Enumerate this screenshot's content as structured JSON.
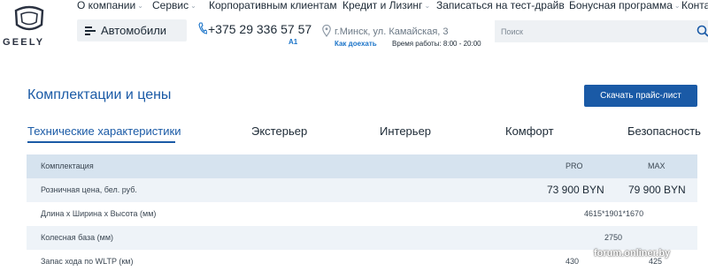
{
  "logo": {
    "wordmark": "GEELY"
  },
  "topnav": {
    "items": [
      {
        "label": "О компании",
        "has_dropdown": true
      },
      {
        "label": "Сервис",
        "has_dropdown": true
      },
      {
        "label": "Корпоративным клиентам",
        "has_dropdown": false
      },
      {
        "label": "Кредит и Лизинг",
        "has_dropdown": true
      },
      {
        "label": "Записаться на тест-драйв",
        "has_dropdown": false
      },
      {
        "label": "Бонусная программа",
        "has_dropdown": true
      },
      {
        "label": "Конта",
        "has_dropdown": false
      }
    ]
  },
  "cars_button": {
    "label": "Автомобили"
  },
  "phone": {
    "number": "+375 29 336 57 57",
    "operator_badge": "A1"
  },
  "location": {
    "address": "г.Минск, ул. Камайская, 3",
    "directions_label": "Как доехать",
    "hours": "Время работы: 8:00 - 20:00"
  },
  "search": {
    "placeholder": "Поиск"
  },
  "page": {
    "title": "Комплектации и цены",
    "price_list_button": "Скачать прайс-лист"
  },
  "tabs": [
    {
      "label": "Технические характеристики",
      "active": true
    },
    {
      "label": "Экстерьер",
      "active": false
    },
    {
      "label": "Интерьер",
      "active": false
    },
    {
      "label": "Комфорт",
      "active": false
    },
    {
      "label": "Безопасность",
      "active": false
    }
  ],
  "spec_table": {
    "header": {
      "label": "Комплектация",
      "col1": "PRO",
      "col2": "MAX"
    },
    "price_row": {
      "label": "Розничная цена, бел. руб.",
      "col1": "73 900 BYN",
      "col2": "79 900 BYN"
    },
    "rows": [
      {
        "label": "Длина х Ширина х Высота (мм)",
        "shared": "4615*1901*1670"
      },
      {
        "label": "Колесная база (мм)",
        "shared": "2750"
      },
      {
        "label": "Запас хода по WLTP (км)",
        "col1": "430",
        "col2": "425"
      }
    ]
  },
  "watermark": {
    "text": "forum.onliner.by"
  },
  "colors": {
    "accent": "#1a5aa6",
    "header_row": "#d6e3ef",
    "shaded_row": "#eef3f8",
    "control_bg": "#eef1f4"
  }
}
